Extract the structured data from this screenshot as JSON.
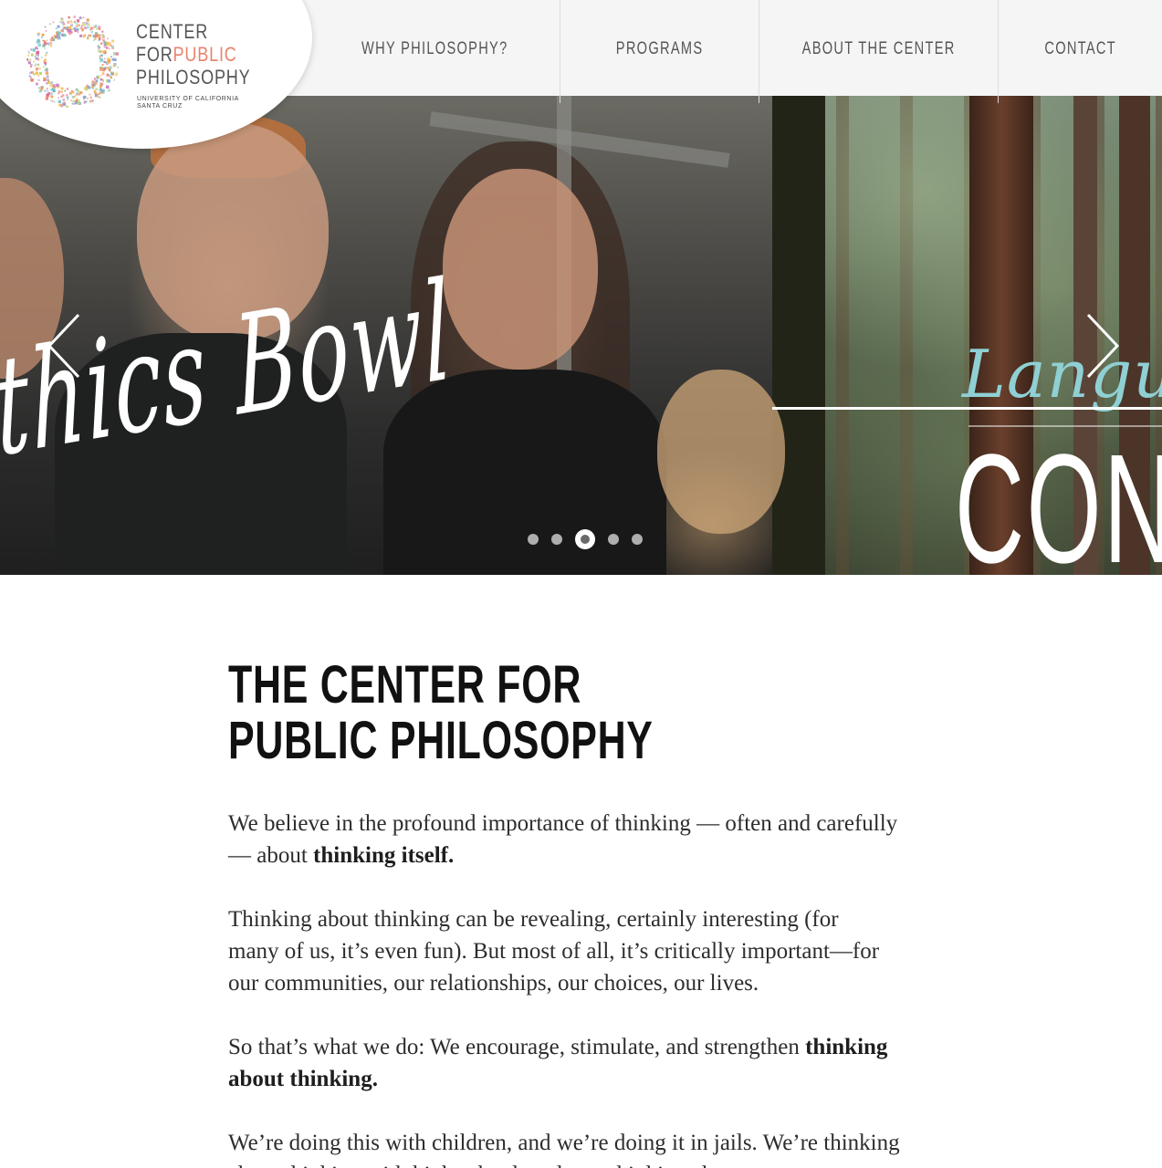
{
  "logo": {
    "line1": "CENTER",
    "line2_a": "FOR",
    "line2_b": "PUBLIC",
    "line3": "PHILOSOPHY",
    "sub1": "UNIVERSITY OF CALIFORNIA",
    "sub2": "SANTA CRUZ",
    "accent_color": "#e8836d"
  },
  "nav": {
    "items": [
      {
        "label": "WHY PHILOSOPHY?"
      },
      {
        "label": "PROGRAMS"
      },
      {
        "label": "ABOUT THE CENTER"
      },
      {
        "label": "CONTACT"
      }
    ]
  },
  "hero": {
    "slide_left_text": "thics Bowl",
    "slide_right_script": "Langua",
    "slide_right_caps": "CON",
    "dots": {
      "count": 5,
      "active_index": 2
    },
    "prev_icon": "chevron-left-icon",
    "next_icon": "chevron-right-icon"
  },
  "main": {
    "title_line1": "THE CENTER FOR",
    "title_line2": "PUBLIC PHILOSOPHY",
    "p1_a": "We believe in the profound importance of thinking — often and carefully — about ",
    "p1_b": "thinking itself.",
    "p2": "Thinking about thinking can be revealing, certainly interesting (for many of us, it’s even fun).  But most of all, it’s critically important—for our communities, our relationships, our choices, our lives.",
    "p3_a": "So that’s what we do: We encourage, stimulate, and strengthen ",
    "p3_b": "thinking about thinking.",
    "p4": "We’re doing this with children, and we’re doing it in jails.  We’re thinking about thinking with high school students, thinking about"
  }
}
